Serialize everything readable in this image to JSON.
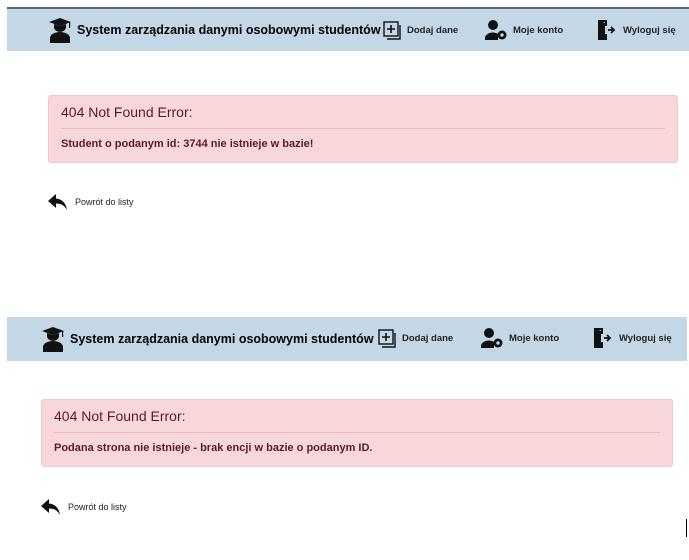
{
  "screens": [
    {
      "header": {
        "title": "System zarządzania danymi osobowymi studentów",
        "nav": {
          "add_data": "Dodaj dane",
          "my_account": "Moje konto",
          "logout": "Wyloguj się"
        }
      },
      "error": {
        "heading": "404 Not Found Error:",
        "message": "Student o podanym id: 3744 nie istnieje w bazie!"
      },
      "back_link": "Powrót do listy"
    },
    {
      "header": {
        "title": "System zarządzania danymi osobowymi studentów",
        "nav": {
          "add_data": "Dodaj dane",
          "my_account": "Moje konto",
          "logout": "Wyloguj się"
        }
      },
      "error": {
        "heading": "404 Not Found Error:",
        "message": "Podana strona nie istnieje - brak encji w bazie o podanym ID."
      },
      "back_link": "Powrót do listy"
    }
  ],
  "colors": {
    "navbar_bg": "#c4d7e6",
    "alert_bg": "#f8d7da",
    "alert_text": "#721c24"
  },
  "icons": {
    "brand": "graduate-icon",
    "add_data": "plus-square-icon",
    "my_account": "user-gear-icon",
    "logout": "logout-door-icon",
    "back": "reply-arrow-icon"
  }
}
